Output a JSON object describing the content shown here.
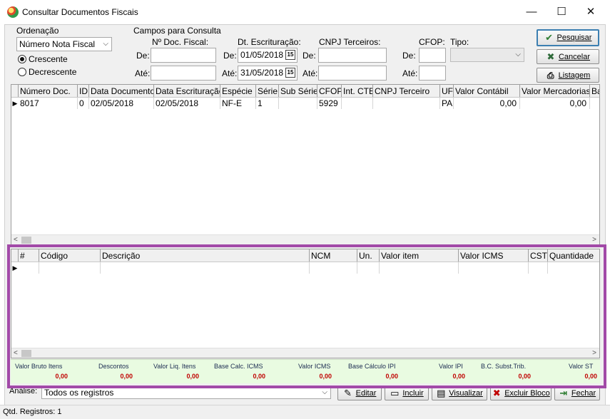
{
  "window": {
    "title": "Consultar Documentos Fiscais",
    "minimize": "—",
    "maximize": "☐",
    "close": "✕"
  },
  "ordenacao": {
    "label": "Ordenação",
    "selected": "Número Nota Fiscal",
    "radio_crescente": "Crescente",
    "radio_decrescente": "Decrescente"
  },
  "campos": {
    "label": "Campos para Consulta",
    "num_doc_label": "Nº Doc. Fiscal:",
    "de": "De:",
    "ate": "Até:",
    "dt_escrit_label": "Dt. Escrituração:",
    "dt_de": "01/05/2018",
    "dt_ate": "31/05/2018",
    "cnpj_label": "CNPJ Terceiros:",
    "cfop_label": "CFOP:",
    "tipo_label": "Tipo:"
  },
  "buttons": {
    "pesquisar": "Pesquisar",
    "cancelar": "Cancelar",
    "listagem": "Listagem"
  },
  "docs_grid": {
    "headers": [
      "Número Doc.",
      "ID",
      "Data Documento",
      "Data Escrituração",
      "Espécie",
      "Série",
      "Sub Série",
      "CFOP",
      "Int. CTB",
      "CNPJ Terceiro",
      "UF",
      "Valor Contábil",
      "Valor Mercadorias",
      "Ba"
    ],
    "row": [
      "8017",
      "0",
      "02/05/2018",
      "02/05/2018",
      "NF-E",
      "1",
      "",
      "5929",
      "",
      "",
      "PA",
      "0,00",
      "0,00",
      ""
    ]
  },
  "items_grid": {
    "headers": [
      "#",
      "Código",
      "Descrição",
      "NCM",
      "Un.",
      "Valor item",
      "Valor ICMS",
      "CST",
      "Quantidade"
    ]
  },
  "totals": {
    "labels": [
      "Valor Bruto Itens",
      "Descontos",
      "Valor Liq. Itens",
      "Base Calc. ICMS",
      "Valor ICMS",
      "Base Cálculo IPI",
      "Valor IPI",
      "B.C. Subst.Trib.",
      "Valor ST"
    ],
    "values": [
      "0,00",
      "0,00",
      "0,00",
      "0,00",
      "0,00",
      "0,00",
      "0,00",
      "0,00",
      "0,00"
    ]
  },
  "bottom": {
    "analise_label": "Análise:",
    "analise_value": "Todos os registros",
    "editar": "Editar",
    "incluir": "Incluir",
    "visualizar": "Visualizar",
    "excluir": "Excluir Bloco",
    "fechar": "Fechar"
  },
  "status": "Qtd. Registros: 1",
  "colors": {
    "highlight": "#a24aa8",
    "totals_bg": "#e9fbe1",
    "totals_value": "#c00000"
  }
}
